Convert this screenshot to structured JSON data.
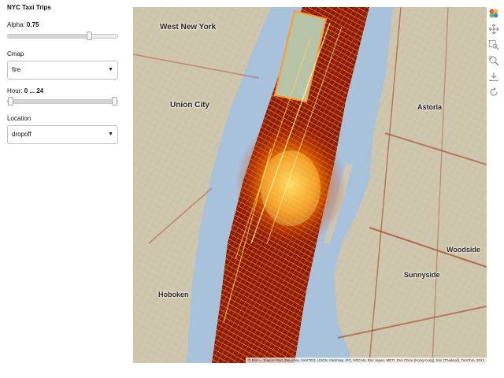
{
  "app": {
    "title": "NYC Taxi Trips"
  },
  "controls": {
    "alpha": {
      "label": "Alpha:",
      "value": "0.75",
      "fraction": 0.75
    },
    "cmap": {
      "label": "Cmap",
      "selected": "fire"
    },
    "hour": {
      "label": "Hour:",
      "value": "0 ... 24",
      "range": [
        0,
        24
      ],
      "min": 0,
      "max": 24
    },
    "location": {
      "label": "Location",
      "selected": "dropoff"
    }
  },
  "map": {
    "places": [
      "West New York",
      "Union City",
      "Astoria",
      "Hoboken",
      "Woodside",
      "Sunnyside"
    ],
    "attribution": "© Esri — Source: Esri, DeLorme, NAVTEQ, USGS, Intermap, iPC, NRCAN, Esri Japan, METI, Esri China (Hong Kong), Esri (Thailand), TomTom, 2012",
    "colors": {
      "water": "#a9c2dc",
      "land": "#cfc6ae",
      "park": "#b7c3a6",
      "heat_low": "#9b1b00",
      "heat_mid": "#ff8c00",
      "heat_high": "#ffffc0"
    }
  },
  "toolbar": {
    "tools": [
      "bokeh-logo-icon",
      "pan-icon",
      "box-zoom-icon",
      "wheel-zoom-icon",
      "save-icon",
      "reset-icon"
    ]
  }
}
